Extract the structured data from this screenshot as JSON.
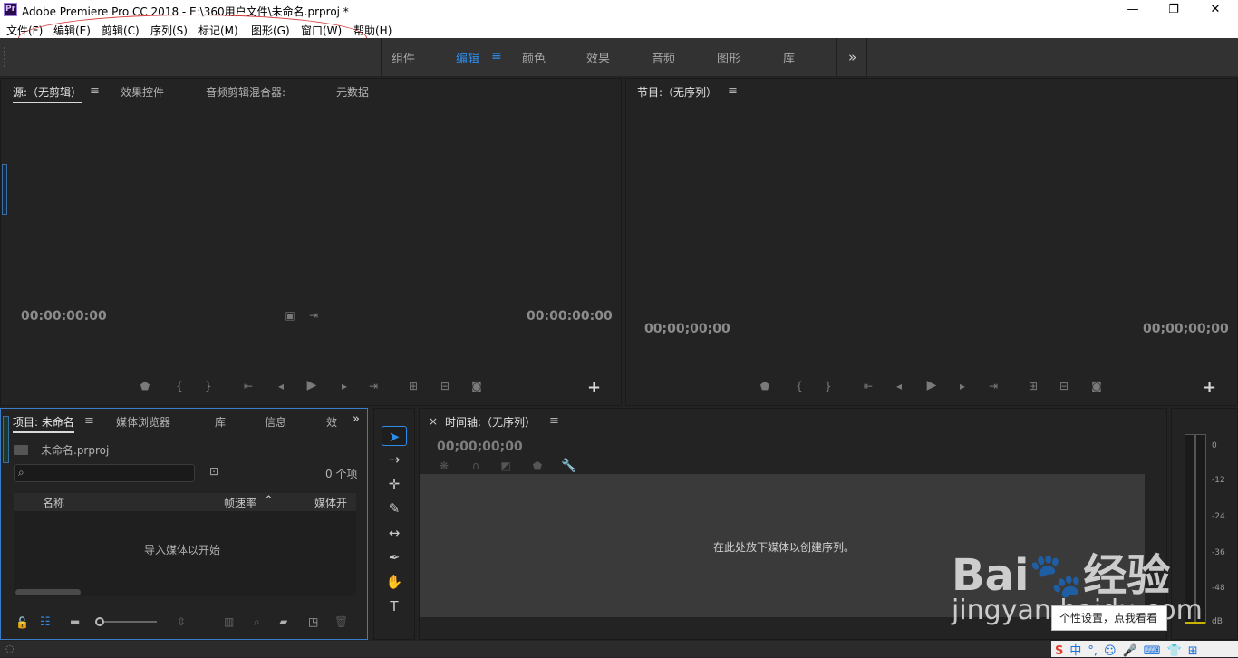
{
  "window": {
    "title": "Adobe Premiere Pro CC 2018 - E:\\360用户文件\\未命名.prproj *",
    "app_icon_text": "Pr",
    "controls": {
      "minimize": "—",
      "maximize": "❐",
      "close": "✕"
    }
  },
  "menu": [
    "文件(F)",
    "编辑(E)",
    "剪辑(C)",
    "序列(S)",
    "标记(M)",
    "图形(G)",
    "窗口(W)",
    "帮助(H)"
  ],
  "workspaces": {
    "tabs": [
      "组件",
      "编辑",
      "颜色",
      "效果",
      "音频",
      "图形",
      "库"
    ],
    "active": "编辑",
    "menu_icon": "≡",
    "overflow": "»"
  },
  "source_panel": {
    "tabs": [
      "源:（无剪辑）",
      "效果控件",
      "音频剪辑混合器:",
      "元数据"
    ],
    "timecode_left": "00:00:00:00",
    "timecode_right": "00:00:00:00",
    "add": "+"
  },
  "program_panel": {
    "title": "节目:（无序列）",
    "timecode_left": "00;00;00;00",
    "timecode_right": "00;00;00;00",
    "add": "+"
  },
  "project_panel": {
    "tabs": [
      "项目: 未命名",
      "媒体浏览器",
      "库",
      "信息",
      "效"
    ],
    "project_file": "未命名.prproj",
    "item_count": "0 个项",
    "columns": [
      "名称",
      "帧速率",
      "媒体开始"
    ],
    "empty_text": "导入媒体以开始"
  },
  "timeline_panel": {
    "title": "时间轴:（无序列）",
    "close": "×",
    "timecode": "00;00;00;00",
    "drop_text": "在此处放下媒体以创建序列。"
  },
  "audio_meter": {
    "labels": [
      "0",
      "-12",
      "-24",
      "-36",
      "-48",
      "dB"
    ]
  },
  "watermark": {
    "brand": "Bai🐾经验",
    "url": "jingyan.baidu.com"
  },
  "tooltip": "个性设置，点我看看",
  "ime_bar": {
    "items": [
      "S",
      "中",
      "°,",
      "☺",
      "🎤",
      "⌨",
      "👕",
      "⊞"
    ],
    "accent": "#1b6fd6"
  },
  "colors": {
    "accent": "#2d8ceb",
    "panel_bg": "#232323",
    "workspace_bg": "#323232",
    "selection_border": "#3a7cc9"
  }
}
